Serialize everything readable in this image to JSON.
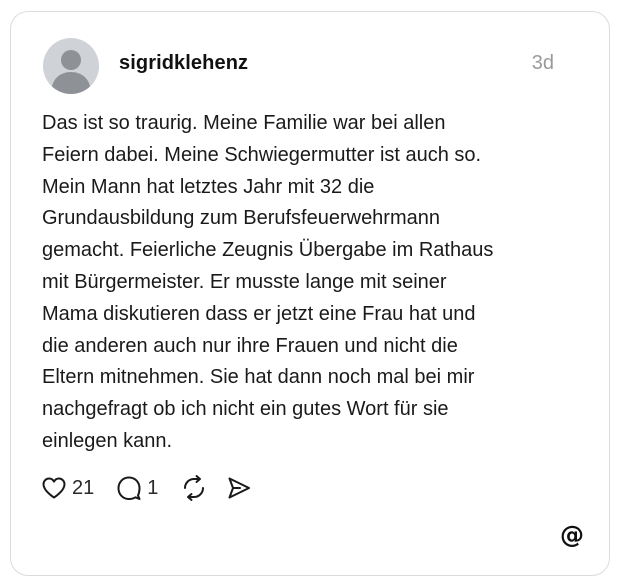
{
  "post": {
    "username": "sigridklehenz",
    "timestamp": "3d",
    "lines": [
      "Das ist so traurig. Meine Familie war bei allen",
      "Feiern dabei. Meine Schwiegermutter ist auch so.",
      "Mein Mann hat letztes Jahr mit 32 die",
      "Grundausbildung zum Berufsfeuerwehrmann",
      "gemacht. Feierliche Zeugnis Übergabe im Rathaus",
      "mit Bürgermeister. Er musste lange mit seiner",
      "Mama diskutieren dass er jetzt eine Frau hat und",
      "die anderen auch nur ihre Frauen und nicht die",
      "Eltern mitnehmen. Sie hat dann noch mal bei mir",
      "nachgefragt ob ich nicht ein gutes Wort für sie",
      "einlegen kann."
    ],
    "likes": "21",
    "replies": "1"
  },
  "icons": {
    "avatar": "default-avatar-icon",
    "like": "heart-icon",
    "reply": "speech-bubble-icon",
    "repost": "repost-icon",
    "share": "send-icon",
    "brand": "threads-logo-icon"
  },
  "colors": {
    "border": "#dcdcdc",
    "avatar_bg": "#cfd2d6",
    "avatar_fg": "#ffffff",
    "text": "#1a1a1a",
    "muted": "#9a9a9a"
  },
  "brand": {
    "logo_glyph": "@"
  }
}
